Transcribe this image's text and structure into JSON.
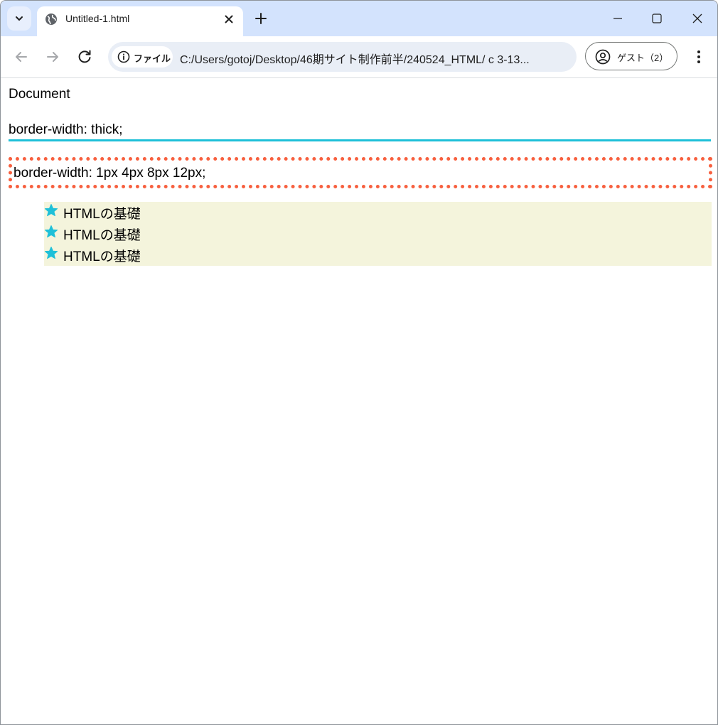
{
  "browser": {
    "tab": {
      "title": "Untitled-1.html"
    },
    "address": {
      "chip_label": "ファイル",
      "url": "C:/Users/gotoj/Desktop/46期サイト制作前半/240524_HTML/ c 3-13..."
    },
    "profile": {
      "label": "ゲスト（2）"
    }
  },
  "page": {
    "title": "Document",
    "thick_box_text": "border-width: thick;",
    "dotted_box_text": "border-width: 1px 4px 8px 12px;",
    "list_items": [
      {
        "label": "HTMLの基礎"
      },
      {
        "label": "HTMLの基礎"
      },
      {
        "label": "HTMLの基礎"
      }
    ]
  },
  "colors": {
    "tabstrip": "#d3e3fd",
    "thick_border": "#1ec0d8",
    "dotted_border": "#f7603f",
    "list_background": "#f4f4dc",
    "star": "#1ec0d8"
  }
}
